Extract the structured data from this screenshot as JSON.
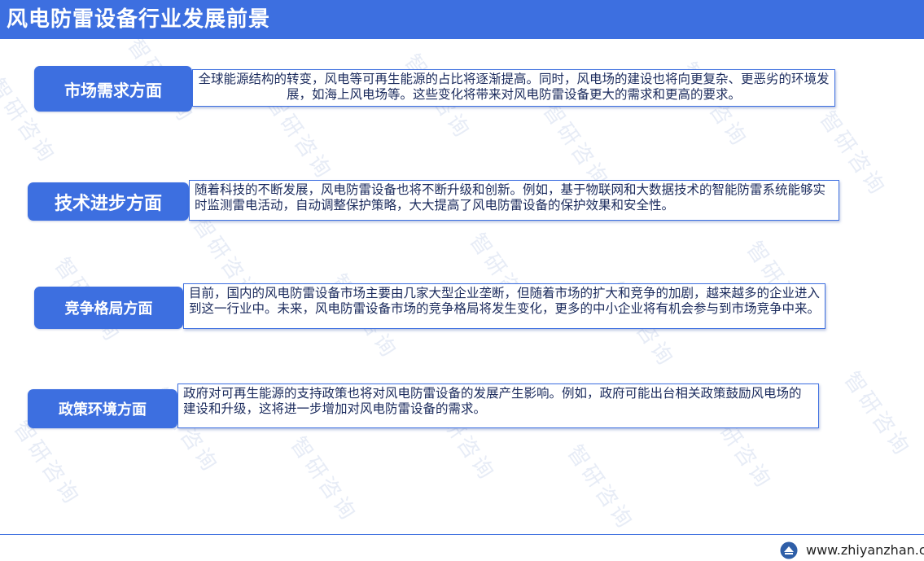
{
  "header": {
    "title": "风电防雷设备行业发展前景"
  },
  "sections": [
    {
      "label": "市场需求方面",
      "text": "全球能源结构的转变，风电等可再生能源的占比将逐渐提高。同时，风电场的建设也将向更复杂、更恶劣的环境发展，如海上风电场等。这些变化将带来对风电防雷设备更大的需求和更高的要求。"
    },
    {
      "label": "技术进步方面",
      "text": "随着科技的不断发展，风电防雷设备也将不断升级和创新。例如，基于物联网和大数据技术的智能防雷系统能够实时监测雷电活动，自动调整保护策略，大大提高了风电防雷设备的保护效果和安全性。"
    },
    {
      "label": "竞争格局方面",
      "text": "目前，国内的风电防雷设备市场主要由几家大型企业垄断，但随着市场的扩大和竞争的加剧，越来越多的企业进入到这一行业中。未来，风电防雷设备市场的竞争格局将发生变化，更多的中小企业将有机会参与到市场竞争中来。"
    },
    {
      "label": "政策环境方面",
      "text": "政府对可再生能源的支持政策也将对风电防雷设备的发展产生影响。例如，政府可能出台相关政策鼓励风电场的建设和升级，这将进一步增加对风电防雷设备的需求。"
    }
  ],
  "watermark": "智研咨询",
  "footer": {
    "url": "www.zhiyanzhan.cn"
  },
  "colors": {
    "accent": "#3d6fe0",
    "text": "#1a2a5c",
    "watermark": "#dfe6f4"
  }
}
